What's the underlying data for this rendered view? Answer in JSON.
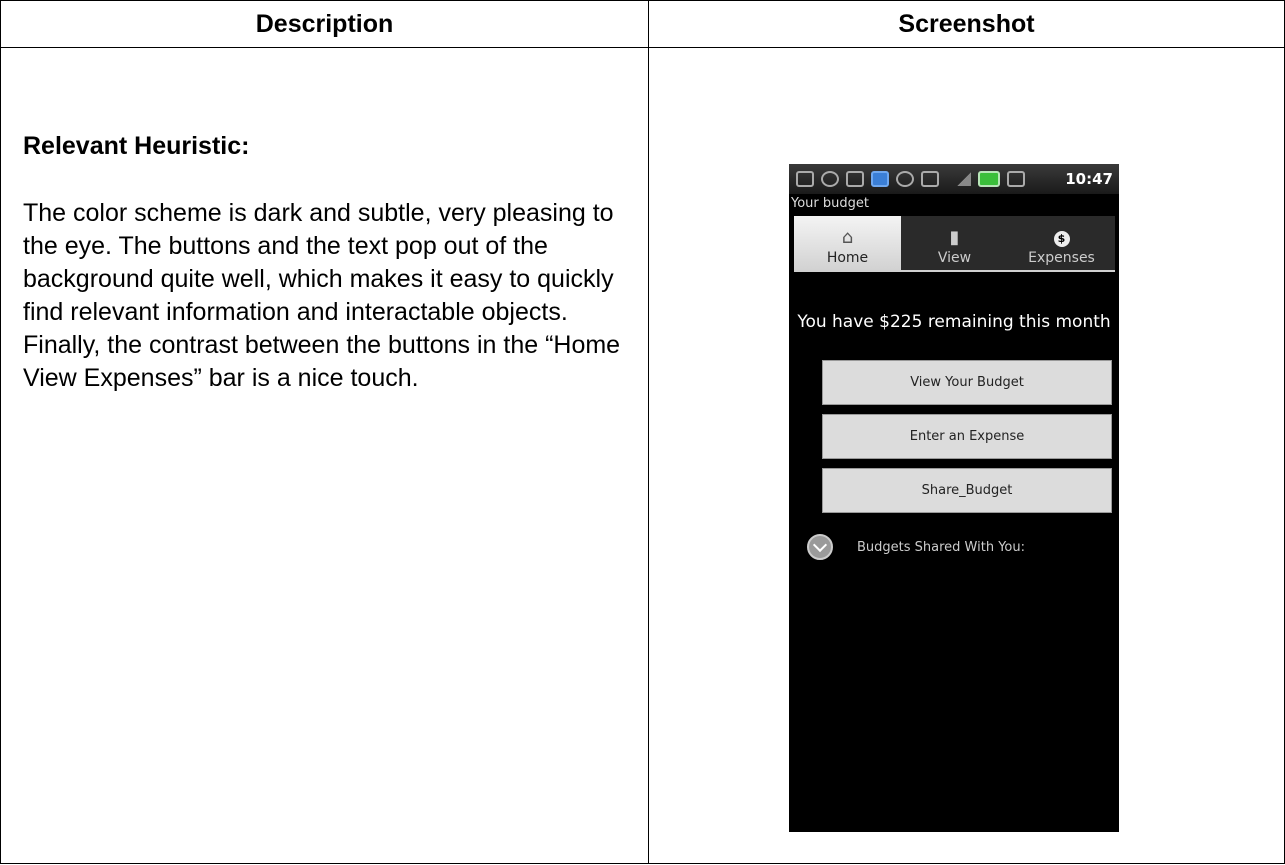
{
  "table": {
    "col1_header": "Description",
    "col2_header": "Screenshot"
  },
  "description": {
    "heading": "Relevant Heuristic:",
    "body": "The color scheme is dark and subtle, very pleasing to the eye.  The buttons and the text pop out of the background quite well, which makes it easy to quickly find relevant information and interactable objects.  Finally, the contrast between the buttons in the “Home View Expenses” bar is a nice touch."
  },
  "phone": {
    "status_time": "10:47",
    "app_title": "Your budget",
    "tabs": [
      {
        "label": "Home",
        "icon": "home-icon"
      },
      {
        "label": "View",
        "icon": "view-icon"
      },
      {
        "label": "Expenses",
        "icon": "dollar-coin-icon"
      }
    ],
    "remaining_text": "You have $225 remaining this month",
    "buttons": {
      "view_budget": "View Your Budget",
      "enter_expense": "Enter an Expense",
      "share_budget": "Share_Budget"
    },
    "shared_label": "Budgets Shared With You:",
    "colors": {
      "background": "#000000",
      "active_tab": "#e0e0e0",
      "button": "#dcdcdc"
    }
  }
}
